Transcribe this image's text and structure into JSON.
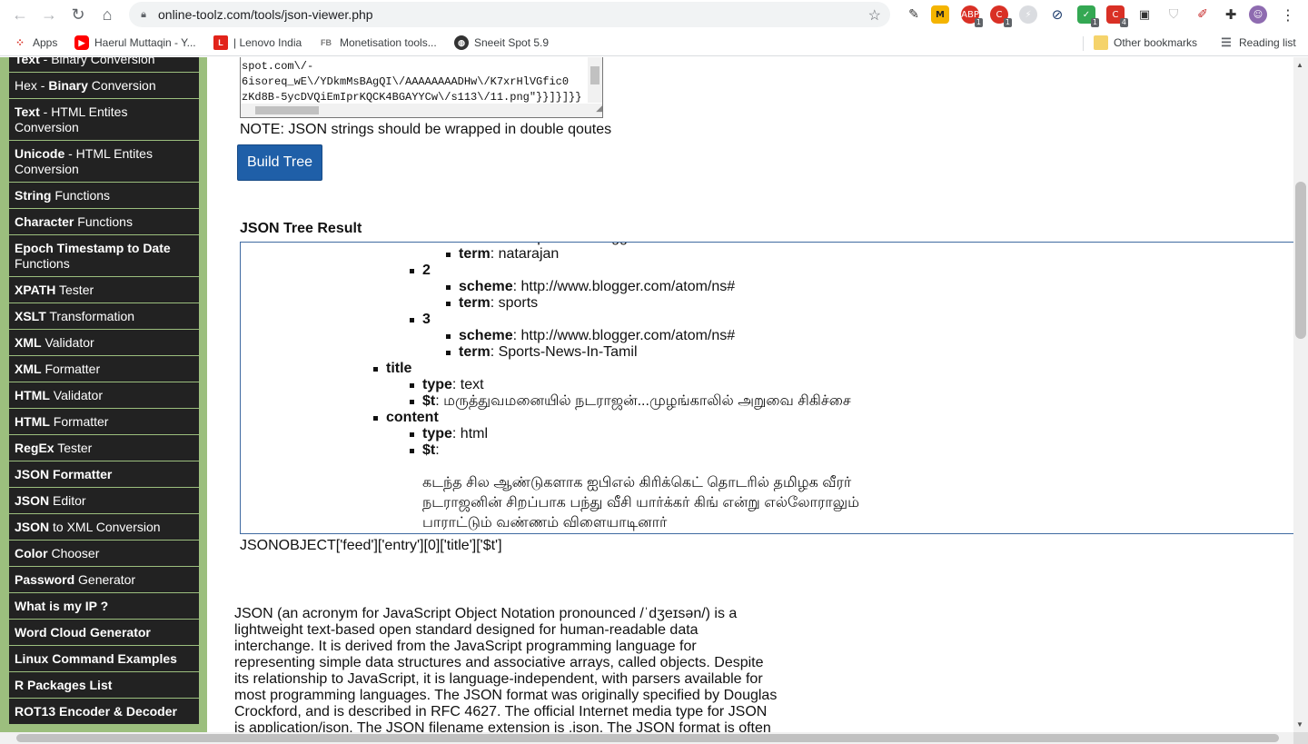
{
  "browser": {
    "url": "online-toolz.com/tools/json-viewer.php",
    "bookmarks": [
      {
        "label": "Apps",
        "icon": "apps-icon"
      },
      {
        "label": "Haerul Muttaqin - Y...",
        "icon": "youtube-icon"
      },
      {
        "label": "| Lenovo India",
        "icon": "lenovo-icon"
      },
      {
        "label": "Monetisation tools...",
        "icon": "fb-icon"
      },
      {
        "label": "Sneeit Spot 5.9",
        "icon": "globe-icon"
      }
    ],
    "other_bookmarks": "Other bookmarks",
    "reading_list": "Reading list",
    "extension_badges": [
      "1",
      "1",
      "1",
      "1",
      "4"
    ]
  },
  "sidebar": {
    "items": [
      {
        "bold": "Text",
        "rest": " - Binary Conversion"
      },
      {
        "bold": "Binary",
        "pre": "Hex - ",
        "rest": " Conversion"
      },
      {
        "bold": "Text",
        "rest": " - HTML Entites Conversion"
      },
      {
        "bold": "Unicode",
        "rest": " - HTML Entites Conversion"
      },
      {
        "bold": "String",
        "rest": " Functions"
      },
      {
        "bold": "Character",
        "rest": " Functions"
      },
      {
        "bold": "Epoch Timestamp to Date",
        "rest": " Functions"
      },
      {
        "bold": "XPATH",
        "rest": " Tester"
      },
      {
        "bold": "XSLT",
        "rest": " Transformation"
      },
      {
        "bold": "XML",
        "rest": " Validator"
      },
      {
        "bold": "XML",
        "rest": " Formatter"
      },
      {
        "bold": "HTML",
        "rest": " Validator"
      },
      {
        "bold": "HTML",
        "rest": " Formatter"
      },
      {
        "bold": "RegEx",
        "rest": " Tester"
      },
      {
        "bold": "JSON Formatter",
        "rest": ""
      },
      {
        "bold": "JSON",
        "rest": " Editor"
      },
      {
        "bold": "JSON",
        "rest": " to XML Conversion"
      },
      {
        "bold": "Color",
        "rest": " Chooser"
      },
      {
        "bold": "Password",
        "rest": " Generator"
      },
      {
        "bold": "What is my IP ?",
        "rest": ""
      },
      {
        "bold": "Word Cloud Generator",
        "rest": ""
      },
      {
        "bold": "Linux Command Examples",
        "rest": ""
      },
      {
        "bold": "R Packages List",
        "rest": ""
      },
      {
        "bold": "ROT13 Encoder & Decoder",
        "rest": ""
      }
    ]
  },
  "input": {
    "lines": [
      "spot.com\\/-",
      "6isoreq_wE\\/YDkmMsBAgQI\\/AAAAAAAADHw\\/K7xrHlVGfic0",
      "zKd8B-5ycDVQiEmIprKQCK4BGAYYCw\\/s113\\/11.png\"}}]}]}}"
    ]
  },
  "note": "NOTE: JSON strings should be wrapped in double qoutes",
  "build_button": "Build Tree",
  "result_title": "JSON Tree Result",
  "tree": [
    {
      "level": 3,
      "key": "scheme",
      "value": ": http://www.blogger.com/atom/ns#"
    },
    {
      "level": 3,
      "key": "term",
      "value": ": natarajan"
    },
    {
      "level": 2,
      "key": "2",
      "value": ""
    },
    {
      "level": 3,
      "key": "scheme",
      "value": ": http://www.blogger.com/atom/ns#"
    },
    {
      "level": 3,
      "key": "term",
      "value": ": sports"
    },
    {
      "level": 2,
      "key": "3",
      "value": ""
    },
    {
      "level": 3,
      "key": "scheme",
      "value": ": http://www.blogger.com/atom/ns#"
    },
    {
      "level": 3,
      "key": "term",
      "value": ": Sports-News-In-Tamil"
    },
    {
      "level": 1,
      "key": "title",
      "value": ""
    },
    {
      "level": 2,
      "key": "type",
      "value": ": text"
    },
    {
      "level": 2,
      "key": "$t",
      "value": ": மருத்துவமனையில் நடராஜன்...முழங்காலில் அறுவை சிகிச்சை"
    },
    {
      "level": 1,
      "key": "content",
      "value": ""
    },
    {
      "level": 2,
      "key": "type",
      "value": ": html"
    },
    {
      "level": 2,
      "key": "$t",
      "value": ":"
    }
  ],
  "content_text": [
    "கடந்த சில ஆண்டுகளாக ஐபிஎல் கிரிக்கெட் தொடரில் தமிழக வீரர்",
    "நடராஜனின் சிறப்பாக பந்து வீசி யார்க்கர் கிங் என்று எல்லோராலும்",
    "பாராட்டும் வண்ணம் விளையாடினார்"
  ],
  "json_path": "JSONOBJECT['feed']['entry'][0]['title']['$t']",
  "description": "JSON (an acronym for JavaScript Object Notation pronounced /ˈdʒeɪsən/) is a lightweight text-based open standard designed for human-readable data interchange. It is derived from the JavaScript programming language for representing simple data structures and associative arrays, called objects. Despite its relationship to JavaScript, it is language-independent, with parsers available for most programming languages. The JSON format was originally specified by Douglas Crockford, and is described in RFC 4627. The official Internet media type for JSON is application/json. The JSON filename extension is .json. The JSON format is often"
}
